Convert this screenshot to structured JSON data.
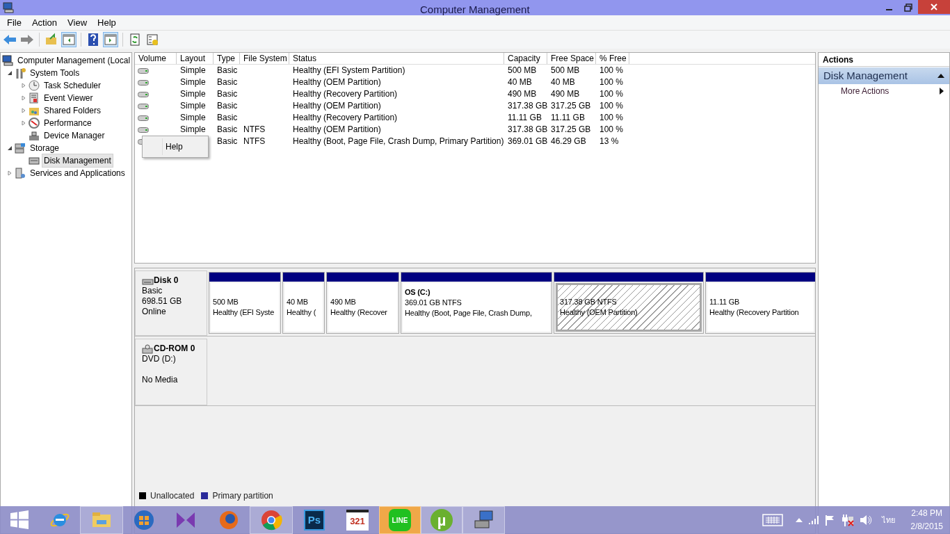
{
  "window": {
    "title": "Computer Management"
  },
  "menu": [
    "File",
    "Action",
    "View",
    "Help"
  ],
  "toolbar": [
    {
      "kind": "back",
      "pressed": false
    },
    {
      "kind": "forward",
      "pressed": false
    },
    {
      "kind": "sep"
    },
    {
      "kind": "up",
      "pressed": false
    },
    {
      "kind": "pane",
      "pressed": true
    },
    {
      "kind": "sep"
    },
    {
      "kind": "help",
      "pressed": false
    },
    {
      "kind": "pane2",
      "pressed": true
    },
    {
      "kind": "sep"
    },
    {
      "kind": "refresh",
      "pressed": false
    },
    {
      "kind": "props",
      "pressed": false
    }
  ],
  "tree": [
    {
      "label": "Computer Management (Local",
      "selected": false,
      "children": [
        {
          "label": "System Tools",
          "expanded": true,
          "selected": false,
          "children": [
            {
              "label": "Task Scheduler",
              "expanded": false,
              "selected": false
            },
            {
              "label": "Event Viewer",
              "expanded": false,
              "selected": false
            },
            {
              "label": "Shared Folders",
              "expanded": false,
              "selected": false
            },
            {
              "label": "Performance",
              "expanded": false,
              "selected": false
            },
            {
              "label": "Device Manager",
              "selected": false
            }
          ]
        },
        {
          "label": "Storage",
          "expanded": true,
          "selected": false,
          "children": [
            {
              "label": "Disk Management",
              "selected": true
            }
          ]
        },
        {
          "label": "Services and Applications",
          "expanded": false,
          "selected": false
        }
      ]
    }
  ],
  "volume_table": {
    "columns": [
      "Volume",
      "Layout",
      "Type",
      "File System",
      "Status",
      "Capacity",
      "Free Space",
      "% Free"
    ],
    "rows": [
      {
        "layout": "Simple",
        "type": "Basic",
        "status": "Healthy (EFI System Partition)",
        "capacity": "500 MB",
        "free": "500 MB",
        "pct": "100 %"
      },
      {
        "layout": "Simple",
        "type": "Basic",
        "status": "Healthy (OEM Partition)",
        "capacity": "40 MB",
        "free": "40 MB",
        "pct": "100 %"
      },
      {
        "layout": "Simple",
        "type": "Basic",
        "status": "Healthy (Recovery Partition)",
        "capacity": "490 MB",
        "free": "490 MB",
        "pct": "100 %"
      },
      {
        "layout": "Simple",
        "type": "Basic",
        "status": "Healthy (OEM Partition)",
        "capacity": "317.38 GB",
        "free": "317.25 GB",
        "pct": "100 %"
      },
      {
        "layout": "Simple",
        "type": "Basic",
        "status": "Healthy (Recovery Partition)",
        "capacity": "11.11 GB",
        "free": "11.11 GB",
        "pct": "100 %"
      },
      {
        "layout": "Simple",
        "type": "Basic",
        "fs": "NTFS",
        "status": "Healthy (OEM Partition)",
        "capacity": "317.38 GB",
        "free": "317.25 GB",
        "pct": "100 %"
      },
      {
        "type": "Basic",
        "fs": "NTFS",
        "status": "Healthy (Boot, Page File, Crash Dump, Primary Partition)",
        "capacity": "369.01 GB",
        "free": "46.29 GB",
        "pct": "13 %"
      }
    ]
  },
  "context_menu": {
    "items": [
      "Help"
    ]
  },
  "disks": [
    {
      "kind": "disk",
      "name": "Disk 0",
      "lines": [
        "Basic",
        "698.51 GB",
        "Online"
      ],
      "partitions": [
        {
          "size": "500 MB",
          "status": "Healthy (EFI Syste",
          "selected": false
        },
        {
          "size": "40 MB",
          "status": "Healthy (",
          "selected": false
        },
        {
          "size": "490 MB",
          "status": "Healthy (Recover",
          "selected": false
        },
        {
          "name": "OS  (C:)",
          "size": "369.01 GB NTFS",
          "status": "Healthy (Boot, Page File, Crash Dump,",
          "selected": false
        },
        {
          "size": "317.38 GB NTFS",
          "status": "Healthy (OEM Partition)",
          "selected": true
        },
        {
          "size": "11.11 GB",
          "status": "Healthy (Recovery Partition",
          "selected": false
        }
      ]
    },
    {
      "kind": "cdrom",
      "name": "CD-ROM 0",
      "lines": [
        "DVD (D:)",
        "No Media"
      ]
    }
  ],
  "legend": [
    {
      "label": "Unallocated",
      "color": "#000000"
    },
    {
      "label": "Primary partition",
      "color": "#2a2a9a"
    }
  ],
  "actions": {
    "title": "Actions",
    "section": "Disk Management",
    "items": [
      "More Actions"
    ]
  },
  "taskbar": {
    "apps": [
      {
        "kind": "start",
        "open": false
      },
      {
        "kind": "ie",
        "open": false
      },
      {
        "kind": "explorer",
        "open": true
      },
      {
        "kind": "wmp",
        "open": false
      },
      {
        "kind": "vs",
        "open": false
      },
      {
        "kind": "firefox",
        "open": false
      },
      {
        "kind": "chrome",
        "open": true
      },
      {
        "kind": "ps",
        "label": "Ps",
        "open": false
      },
      {
        "kind": "mpc",
        "label": "321",
        "open": false
      },
      {
        "kind": "line",
        "label": "LINE",
        "open": true,
        "flashing": true
      },
      {
        "kind": "utorrent",
        "label": "µ",
        "open": true
      },
      {
        "kind": "compmgmt",
        "open": true
      }
    ],
    "language": "ไทย",
    "time": "2:48 PM",
    "date": "2/8/2015"
  }
}
